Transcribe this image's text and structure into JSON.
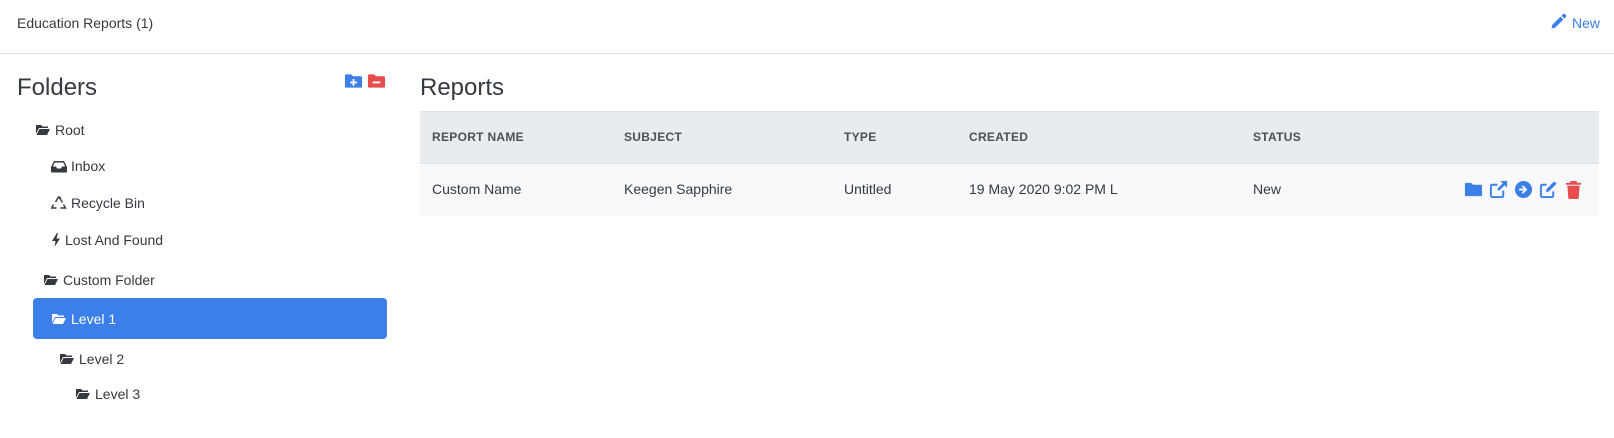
{
  "header": {
    "title": "Education Reports (1)",
    "new_label": "New"
  },
  "sidebar": {
    "heading": "Folders",
    "add_folder_icon": "folder-plus-icon",
    "remove_folder_icon": "folder-minus-icon",
    "items": [
      {
        "label": "Root",
        "icon": "folder-open-icon"
      },
      {
        "label": "Inbox",
        "icon": "inbox-icon"
      },
      {
        "label": "Recycle Bin",
        "icon": "recycle-icon"
      },
      {
        "label": "Lost And Found",
        "icon": "bolt-icon"
      },
      {
        "label": "Custom Folder",
        "icon": "folder-open-icon"
      },
      {
        "label": "Level 1",
        "icon": "folder-open-icon",
        "selected": true
      },
      {
        "label": "Level 2",
        "icon": "folder-open-icon"
      },
      {
        "label": "Level 3",
        "icon": "folder-open-icon"
      }
    ]
  },
  "main": {
    "heading": "Reports",
    "columns": [
      "REPORT NAME",
      "SUBJECT",
      "TYPE",
      "CREATED",
      "STATUS"
    ],
    "rows": [
      {
        "report_name": "Custom Name",
        "subject": "Keegen Sapphire",
        "type": "Untitled",
        "created": "19 May 2020 9:02 PM L",
        "status": "New",
        "actions": [
          "folder-icon",
          "external-link-icon",
          "arrow-circle-right-icon",
          "edit-icon",
          "trash-icon"
        ]
      }
    ]
  },
  "colors": {
    "accent": "#3d7fe8",
    "danger": "#e84c4c",
    "header_bg": "#e9ecef",
    "row_bg": "#f8f9fb"
  }
}
